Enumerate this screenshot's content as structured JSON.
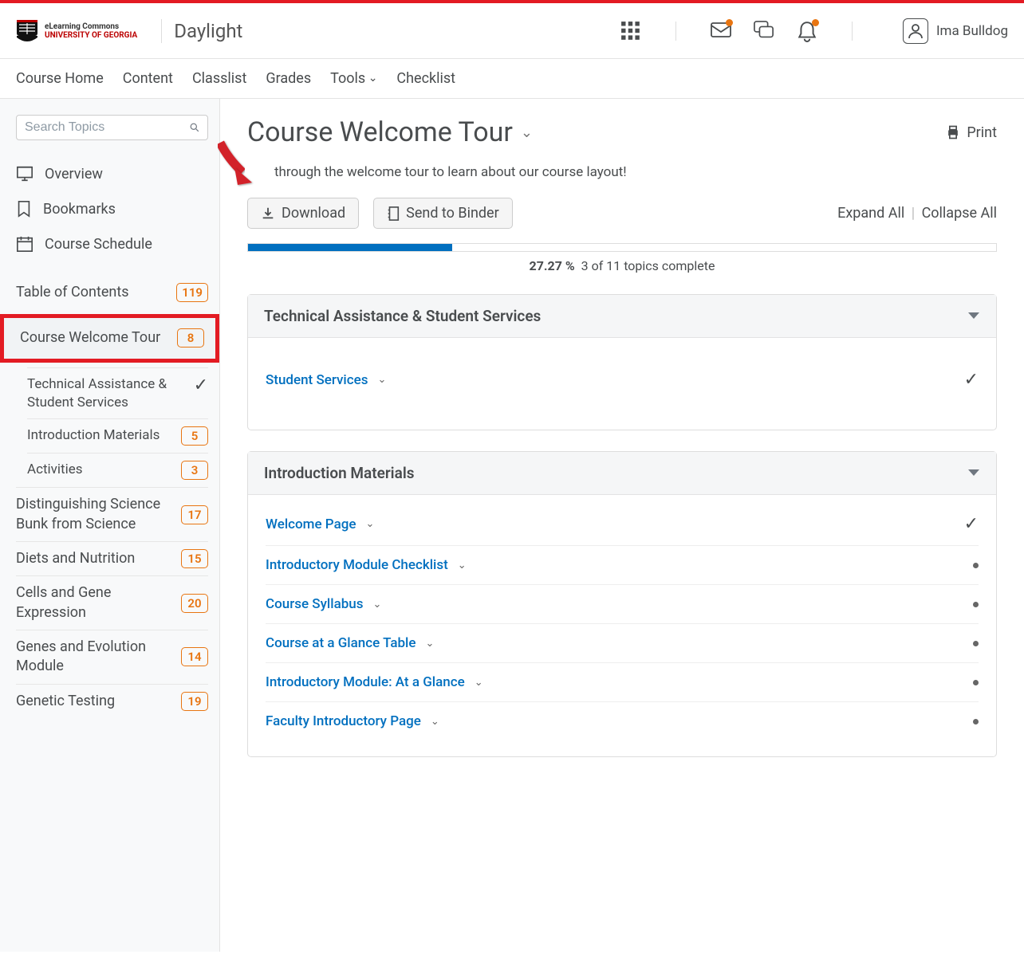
{
  "header": {
    "logo_line1": "eLearning Commons",
    "logo_line2": "UNIVERSITY OF GEORGIA",
    "app_name": "Daylight",
    "user_name": "Ima Bulldog"
  },
  "nav": [
    "Course Home",
    "Content",
    "Classlist",
    "Grades",
    "Tools",
    "Checklist"
  ],
  "sidebar": {
    "search_placeholder": "Search Topics",
    "links": {
      "overview": "Overview",
      "bookmarks": "Bookmarks",
      "schedule": "Course Schedule"
    },
    "toc_label": "Table of Contents",
    "toc_count": "119",
    "highlight": {
      "label": "Course Welcome Tour",
      "count": "8"
    },
    "subs": [
      {
        "label": "Technical Assistance & Student Services",
        "check": true
      },
      {
        "label": "Introduction Materials",
        "count": "5"
      },
      {
        "label": "Activities",
        "count": "3"
      }
    ],
    "modules": [
      {
        "label": "Distinguishing Science Bunk from Science",
        "count": "17"
      },
      {
        "label": "Diets and Nutrition",
        "count": "15"
      },
      {
        "label": "Cells and Gene Expression",
        "count": "20"
      },
      {
        "label": "Genes and Evolution Module",
        "count": "14"
      },
      {
        "label": "Genetic Testing",
        "count": "19"
      }
    ]
  },
  "main": {
    "title": "Course Welcome Tour",
    "print": "Print",
    "desc": "through the welcome tour to learn about our course layout!",
    "download": "Download",
    "send_binder": "Send to Binder",
    "expand": "Expand All",
    "collapse": "Collapse All",
    "progress_pct": "27.27 %",
    "progress_text": "3 of 11 topics complete",
    "progress_fill": "27.27%",
    "panels": [
      {
        "title": "Technical Assistance & Student Services",
        "topics": [
          {
            "label": "Student Services",
            "status": "check"
          }
        ]
      },
      {
        "title": "Introduction Materials",
        "topics": [
          {
            "label": "Welcome Page",
            "status": "check"
          },
          {
            "label": "Introductory Module Checklist",
            "status": "dot"
          },
          {
            "label": "Course Syllabus",
            "status": "dot"
          },
          {
            "label": "Course at a Glance Table",
            "status": "dot"
          },
          {
            "label": "Introductory Module: At a Glance",
            "status": "dot"
          },
          {
            "label": "Faculty Introductory Page",
            "status": "dot"
          }
        ]
      }
    ]
  }
}
